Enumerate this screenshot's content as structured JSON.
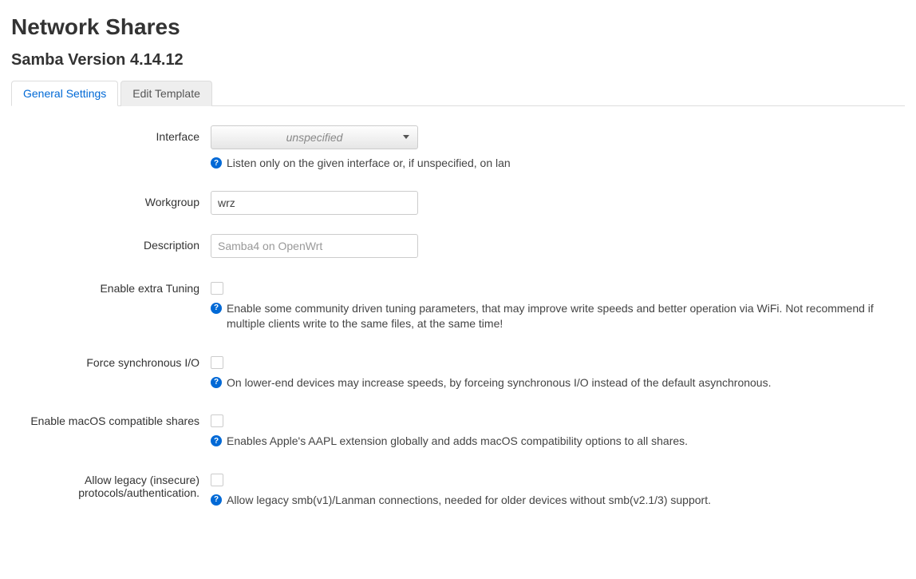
{
  "header": {
    "title": "Network Shares",
    "subtitle": "Samba Version 4.14.12"
  },
  "tabs": [
    {
      "label": "General Settings",
      "active": true
    },
    {
      "label": "Edit Template",
      "active": false
    }
  ],
  "fields": {
    "interface": {
      "label": "Interface",
      "selected": "unspecified",
      "help": "Listen only on the given interface or, if unspecified, on lan"
    },
    "workgroup": {
      "label": "Workgroup",
      "value": "wrz"
    },
    "description": {
      "label": "Description",
      "placeholder": "Samba4 on OpenWrt"
    },
    "extra_tuning": {
      "label": "Enable extra Tuning",
      "help": "Enable some community driven tuning parameters, that may improve write speeds and better operation via WiFi. Not recommend if multiple clients write to the same files, at the same time!"
    },
    "force_sync_io": {
      "label": "Force synchronous I/O",
      "help": "On lower-end devices may increase speeds, by forceing synchronous I/O instead of the default asynchronous."
    },
    "macos_compat": {
      "label": "Enable macOS compatible shares",
      "help": "Enables Apple's AAPL extension globally and adds macOS compatibility options to all shares."
    },
    "allow_legacy": {
      "label": "Allow legacy (insecure) protocols/authentication.",
      "help": "Allow legacy smb(v1)/Lanman connections, needed for older devices without smb(v2.1/3) support."
    }
  }
}
